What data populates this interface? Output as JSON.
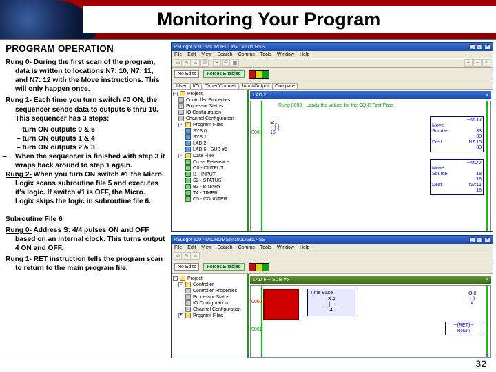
{
  "slide": {
    "title": "Monitoring Your Program",
    "page_number": "32"
  },
  "text": {
    "section_heading": "PROGRAM OPERATION",
    "rung0_label": "Rung 0-",
    "rung0_body": " During the first scan of the program, data is written to locations N7: 10, N7: 11, and N7: 12 with the Move instructions. This will only happen once.",
    "rung1_label": "Rung 1-",
    "rung1_body": " Each time you turn switch #0 ON, the sequencer sends data to outputs 6 thru 10. This sequencer has 3 steps:",
    "step1": "turn ON outputs 0 & 5",
    "step2": "turn ON outputs 1 & 4",
    "step3": "turn ON outputs 2 & 3",
    "seq_wrap": "When the sequencer is finished with step 3 it wraps back around to step 1 again.",
    "rung2_label": "Rung 2-",
    "rung2_body": " When you turn ON switch #1 the Micro. Logix scans subroutine file 5 and executes it's logic. If switch #1 is OFF, the Micro. Logix skips the logic in subroutine file 6.",
    "sub_heading": "Subroutine File 6",
    "sub_rung0_label": "Rung 0-",
    "sub_rung0_body": " Address S: 4/4 pulses ON and OFF based on an internal clock. This turns output 4 ON and OFF.",
    "sub_rung1_label": "Rung 1-",
    "sub_rung1_body": " RET instruction tells the program scan to return to the main program file."
  },
  "win1": {
    "title": "RSLogix 500 - MICROECONV14.L01.RSS",
    "menus": [
      "File",
      "Edit",
      "View",
      "Search",
      "Comms",
      "Tools",
      "Window",
      "Help"
    ],
    "status_left": "No Edits",
    "status_right": "Forces Enabled",
    "tabs": [
      "User",
      "I/O",
      "Timer/Counter",
      "Input/Output",
      "Compare"
    ],
    "tree_root": "Project",
    "tree": [
      "Controller Properties",
      "Processor Status",
      "IO Configuration",
      "Channel Configuration",
      "Program Files",
      "SYS 0",
      "SYS 1",
      "LAD 2 -",
      "LAD 6 - SUB #6",
      "Data Files",
      "Cross Reference",
      "O0 - OUTPUT",
      "I1 - INPUT",
      "S2 - STATUS",
      "B3 - BINARY",
      "T4 - TIMER",
      "C5 - COUNTER"
    ],
    "ladder_title": "LAD 2",
    "ladder_comment": "Rung 0000 - Loads the values for the SQ C First Pass",
    "rung_num1": "0000",
    "mov1": {
      "op": "MOV",
      "source": "33",
      "src2": "33",
      "dest": "N7:10",
      "d2": "33"
    },
    "mov2": {
      "op": "MOV",
      "source": "18",
      "src2": "18",
      "dest": "N7:11",
      "d2": "18"
    }
  },
  "win2": {
    "title": "RSLogix 500 - MICROMSIM100LAB1.RSS",
    "menus": [
      "File",
      "Edit",
      "View",
      "Search",
      "Comms",
      "Tools",
      "Window",
      "Help"
    ],
    "status_left": "No Edits",
    "status_right": "Forces Enabled",
    "tree_root": "Project",
    "tree": [
      "Controller",
      "Controller Properties",
      "Processor Status",
      "IO Configuration",
      "Channel Configuration",
      "Program Files"
    ],
    "ladder_title": "LAD 6 -- SUB #6",
    "rung_num1": "0000",
    "rung_num2": "0001",
    "timer": {
      "label": "Time Base",
      "val1": "S:4",
      "val2": "4",
      "out1": "O:0",
      "out2": "4"
    },
    "ret": "RET",
    "ret_sub": "Return"
  }
}
